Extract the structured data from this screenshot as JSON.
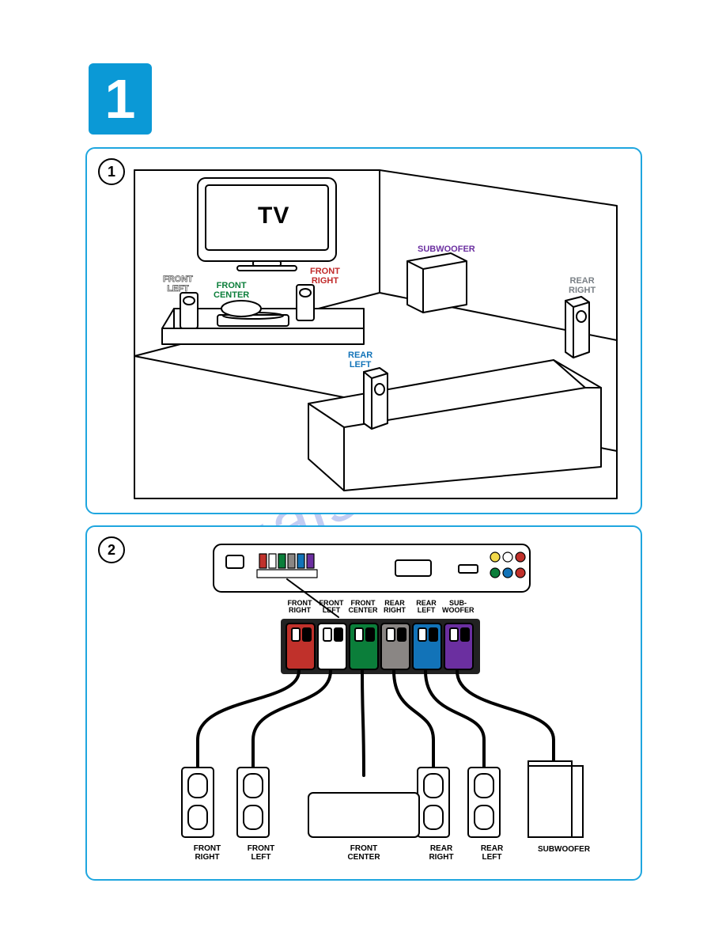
{
  "step_number": "1",
  "watermark_text": "manualshive.com",
  "panel1": {
    "substep": "1",
    "tv_label": "TV",
    "speakers": {
      "front_left": {
        "label_line1": "FRONT",
        "label_line2": "LEFT"
      },
      "front_center": {
        "label_line1": "FRONT",
        "label_line2": "CENTER"
      },
      "front_right": {
        "label_line1": "FRONT",
        "label_line2": "RIGHT"
      },
      "subwoofer": {
        "label_line1": "SUBWOOFER",
        "label_line2": ""
      },
      "rear_left": {
        "label_line1": "REAR",
        "label_line2": "LEFT"
      },
      "rear_right": {
        "label_line1": "REAR",
        "label_line2": "RIGHT"
      }
    }
  },
  "panel2": {
    "substep": "2",
    "terminals": [
      {
        "id": "front_right",
        "label_line1": "FRONT",
        "label_line2": "RIGHT",
        "color": "#c0312b"
      },
      {
        "id": "front_left",
        "label_line1": "FRONT",
        "label_line2": "LEFT",
        "color": "#ffffff"
      },
      {
        "id": "front_center",
        "label_line1": "FRONT",
        "label_line2": "CENTER",
        "color": "#0b7e3a"
      },
      {
        "id": "rear_right",
        "label_line1": "REAR",
        "label_line2": "RIGHT",
        "color": "#8a8684"
      },
      {
        "id": "rear_left",
        "label_line1": "REAR",
        "label_line2": "LEFT",
        "color": "#1273b8"
      },
      {
        "id": "subwoofer",
        "label_line1": "SUB-",
        "label_line2": "WOOFER",
        "color": "#6b2fa0"
      }
    ],
    "bottom_speakers": [
      {
        "id": "front_right",
        "label_line1": "FRONT",
        "label_line2": "RIGHT"
      },
      {
        "id": "front_left",
        "label_line1": "FRONT",
        "label_line2": "LEFT"
      },
      {
        "id": "front_center",
        "label_line1": "FRONT",
        "label_line2": "CENTER"
      },
      {
        "id": "rear_right",
        "label_line1": "REAR",
        "label_line2": "RIGHT"
      },
      {
        "id": "rear_left",
        "label_line1": "REAR",
        "label_line2": "LEFT"
      },
      {
        "id": "subwoofer",
        "label_line1": "SUBWOOFER",
        "label_line2": ""
      }
    ]
  }
}
